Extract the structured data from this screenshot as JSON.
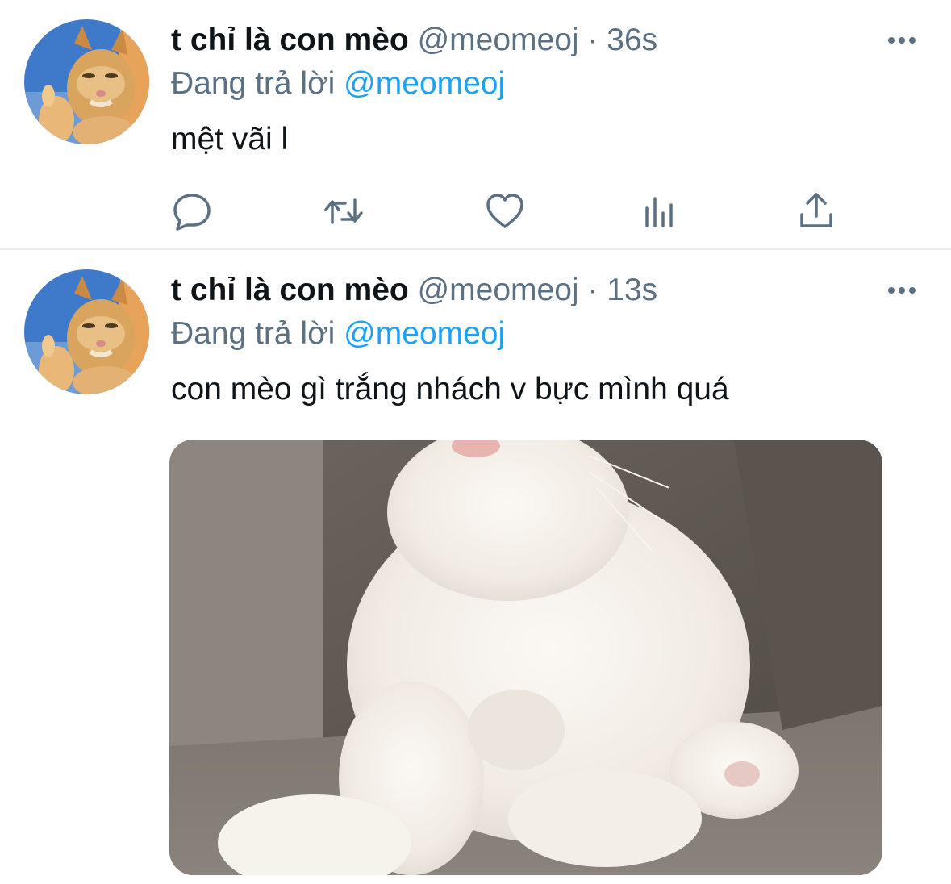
{
  "tweets": [
    {
      "display_name": "t chỉ là con mèo",
      "handle": "@meomeoj",
      "separator": " · ",
      "time": "36s",
      "replying_prefix": "Đang trả lời ",
      "replying_to": "@meomeoj",
      "text": "mệt vãi l",
      "avatar_icon": "cat-thumbs-up-avatar",
      "actions": [
        "reply-icon",
        "retweet-icon",
        "like-icon",
        "analytics-icon",
        "share-icon"
      ]
    },
    {
      "display_name": "t chỉ là con mèo",
      "handle": "@meomeoj",
      "separator": " · ",
      "time": "13s",
      "replying_prefix": "Đang trả lời ",
      "replying_to": "@meomeoj",
      "text": "con mèo gì trắng nhách v bực mình quá",
      "avatar_icon": "cat-thumbs-up-avatar",
      "media": "white-fluffy-cat-photo"
    }
  ],
  "colors": {
    "text_primary": "#0f1419",
    "text_secondary": "#5b7083",
    "mention": "#1da1f2",
    "divider": "#e6ecf0"
  }
}
